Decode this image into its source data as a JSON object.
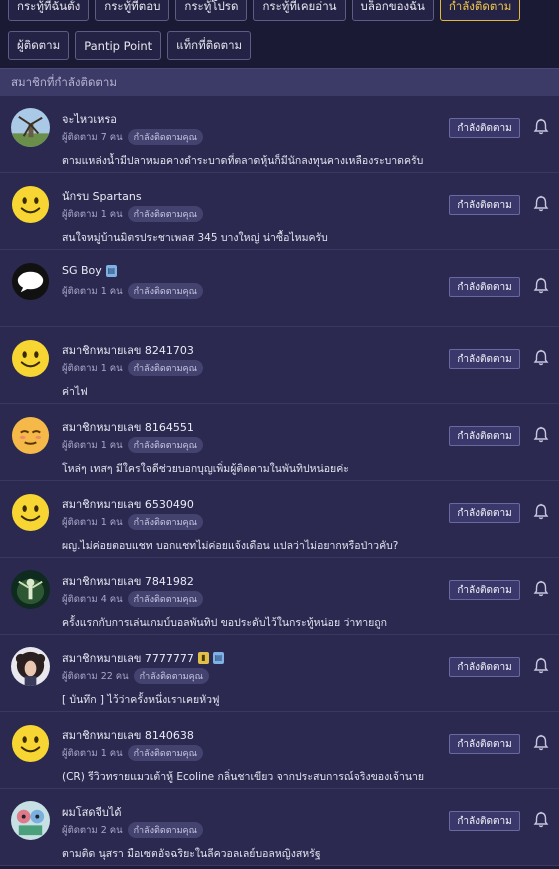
{
  "tabs_row1": [
    {
      "label": "กระทู้ที่ฉันตั้ง",
      "active": false
    },
    {
      "label": "กระทู้ที่ตอบ",
      "active": false
    },
    {
      "label": "กระทู้โปรด",
      "active": false
    },
    {
      "label": "กระทู้ที่เคยอ่าน",
      "active": false
    },
    {
      "label": "บล็อกของฉัน",
      "active": false
    },
    {
      "label": "กำลังติดตาม",
      "active": true
    }
  ],
  "tabs_row2": [
    {
      "label": "ผู้ติดตาม"
    },
    {
      "label": "Pantip Point"
    },
    {
      "label": "แท็กที่ติดตาม"
    }
  ],
  "section_title": "สมาชิกที่กำลังติดตาม",
  "follow_button_label": "กำลังติดตาม",
  "members": [
    {
      "name": "จะไหวเหรอ",
      "followers": "ผู้ติดตาม 7 คน",
      "pill": "กำลังติดตามคุณ",
      "desc": "ตามแหล่งน้ำมีปลาหมอคางดำระบาดที่ตลาดหุ้นก็มีนักลงทุนคางเหลืองระบาดครับ",
      "avatar": "windmill",
      "badges": []
    },
    {
      "name": "นักรบ Spartans",
      "followers": "ผู้ติดตาม 1 คน",
      "pill": "กำลังติดตามคุณ",
      "desc": "สนใจหมู่บ้านมิตรประชาเพลส 345 บางใหญ่ น่าซื้อไหมครับ",
      "avatar": "smiley",
      "badges": []
    },
    {
      "name": "SG Boy",
      "followers": "ผู้ติดตาม 1 คน",
      "pill": "กำลังติดตามคุณ",
      "desc": "",
      "avatar": "speech",
      "badges": [
        "blue"
      ]
    },
    {
      "name": "สมาชิกหมายเลข 8241703",
      "followers": "ผู้ติดตาม 1 คน",
      "pill": "กำลังติดตามคุณ",
      "desc": "ค่าไฟ",
      "avatar": "smiley",
      "badges": []
    },
    {
      "name": "สมาชิกหมายเลข 8164551",
      "followers": "ผู้ติดตาม 1 คน",
      "pill": "กำลังติดตามคุณ",
      "desc": "โหล่ๆ เทสๆ มีใครใจดีช่วยบอกบุญเพิ่มผู้ติดตามในพันทิปหน่อยค่ะ",
      "avatar": "relieved",
      "badges": []
    },
    {
      "name": "สมาชิกหมายเลข 6530490",
      "followers": "ผู้ติดตาม 1 คน",
      "pill": "กำลังติดตามคุณ",
      "desc": "ผญ.ไม่ค่อยตอบแชท บอกแชทไม่ค่อยแจ้งเดือน แปลว่าไม่อยากหรือป่าวคับ?",
      "avatar": "smiley",
      "badges": []
    },
    {
      "name": "สมาชิกหมายเลข 7841982",
      "followers": "ผู้ติดตาม 4 คน",
      "pill": "กำลังติดตามคุณ",
      "desc": "ครั้งแรกกับการเล่นเกมบ์บอลพันทิป ขอประดับไว้ในกระทู้หน่อย ว่าทายถูก",
      "avatar": "angel",
      "badges": []
    },
    {
      "name": "สมาชิกหมายเลข 7777777",
      "followers": "ผู้ติดตาม 22 คน",
      "pill": "กำลังติดตามคุณ",
      "desc": "[ บันทึก ] ไว้ว่าครั้งหนึ่งเราเคยหัวฟู",
      "avatar": "curly",
      "badges": [
        "gold",
        "blue"
      ]
    },
    {
      "name": "สมาชิกหมายเลข 8140638",
      "followers": "ผู้ติดตาม 1 คน",
      "pill": "กำลังติดตามคุณ",
      "desc": "(CR) รีวิวทรายแมวเต้าหู้ Ecoline กลิ่นชาเขียว จากประสบการณ์จริงของเจ้านาย",
      "avatar": "smiley",
      "badges": []
    },
    {
      "name": "ผมโสดจีบได้",
      "followers": "ผู้ติดตาม 2 คน",
      "pill": "กำลังติดตามคุณ",
      "desc": "ตามติด นุสรา มือเซตอัจฉริยะในลีควอลเลย์บอลหญิงสหรัฐ",
      "avatar": "cartoon",
      "badges": []
    }
  ]
}
